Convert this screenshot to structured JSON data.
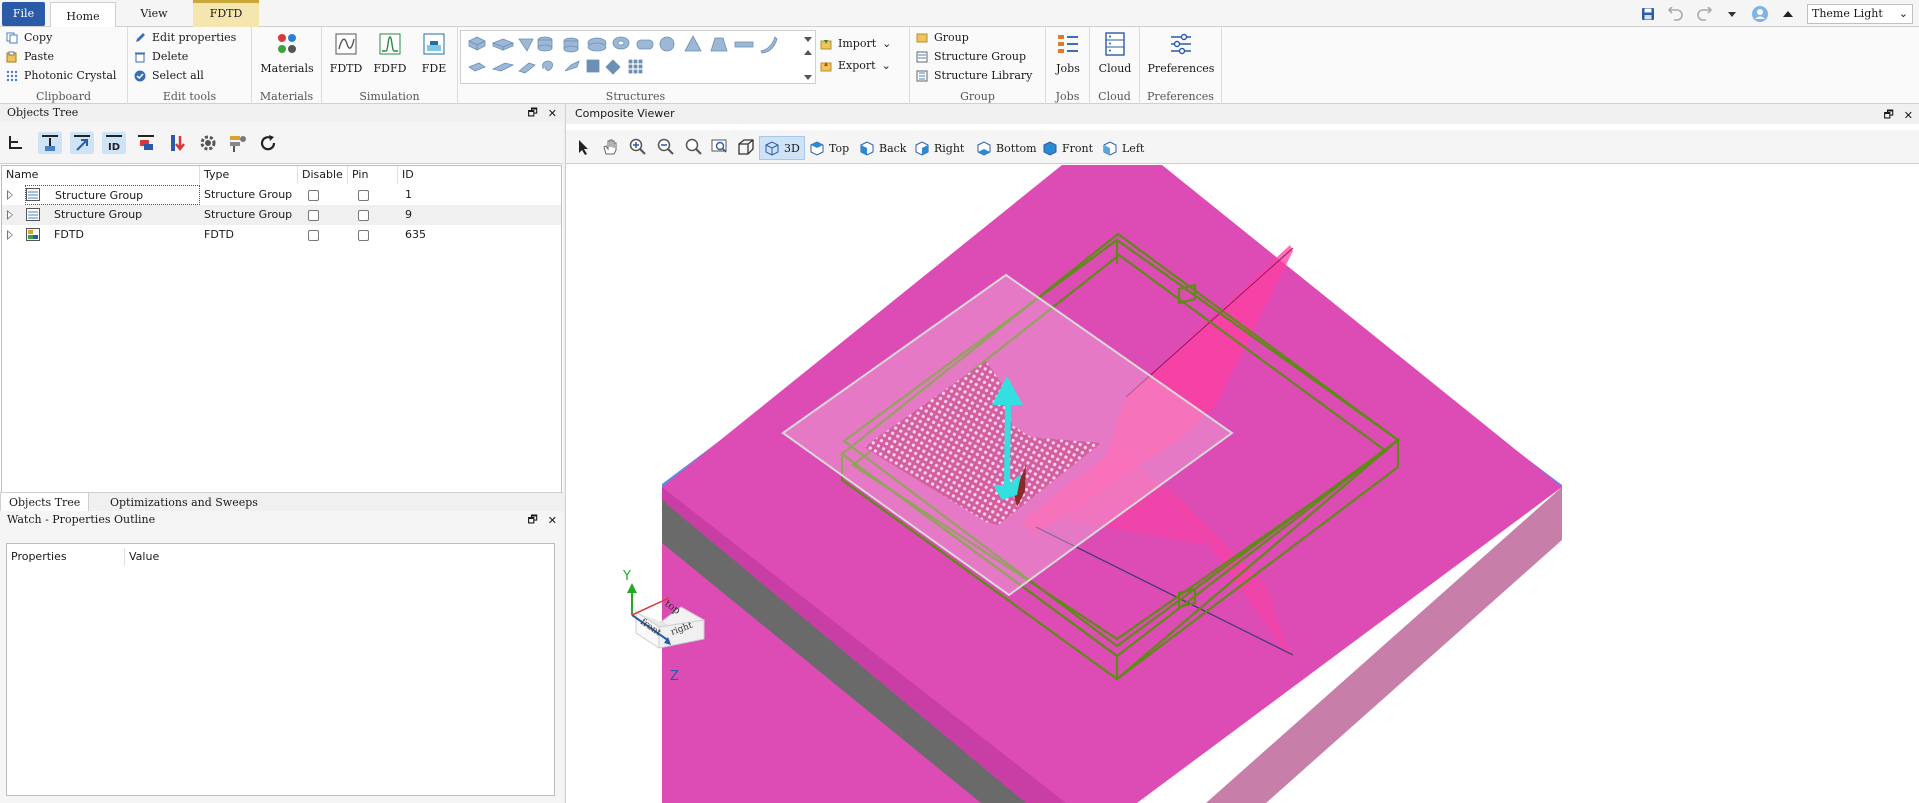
{
  "tabs": {
    "file": "File",
    "home": "Home",
    "view": "View",
    "fdtd": "FDTD"
  },
  "theme": {
    "label": "Theme Light"
  },
  "clipboard": {
    "copy": "Copy",
    "paste": "Paste",
    "photonic": "Photonic Crystal",
    "label": "Clipboard"
  },
  "edit": {
    "edit_properties": "Edit properties",
    "delete": "Delete",
    "select_all": "Select all",
    "label": "Edit tools"
  },
  "materials": {
    "button": "Materials",
    "label": "Materials"
  },
  "simulation": {
    "fdtd": "FDTD",
    "fdfd": "FDFD",
    "fde": "FDE",
    "label": "Simulation"
  },
  "structures": {
    "label": "Structures",
    "import": "Import",
    "export": "Export"
  },
  "group": {
    "group": "Group",
    "structure_group": "Structure Group",
    "structure_library": "Structure Library",
    "label": "Group"
  },
  "jobs": {
    "button": "Jobs",
    "label": "Jobs"
  },
  "cloud": {
    "button": "Cloud",
    "label": "Cloud"
  },
  "preferences": {
    "button": "Preferences",
    "label": "Preferences"
  },
  "objects_tree": {
    "title": "Objects Tree",
    "columns": [
      "Name",
      "Type",
      "Disable",
      "Pin",
      "ID"
    ],
    "rows": [
      {
        "name": "Structure Group",
        "type": "Structure Group",
        "id": "1"
      },
      {
        "name": "Structure Group",
        "type": "Structure Group",
        "id": "9"
      },
      {
        "name": "FDTD",
        "type": "FDTD",
        "id": "635"
      }
    ]
  },
  "bottom_tabs": {
    "objects": "Objects Tree",
    "opt": "Optimizations and Sweeps"
  },
  "watch": {
    "title": "Watch - Properties Outline",
    "col_props": "Properties",
    "col_value": "Value"
  },
  "viewer": {
    "title": "Composite Viewer",
    "views": {
      "v3d": "3D",
      "top": "Top",
      "back": "Back",
      "right": "Right",
      "bottom": "Bottom",
      "front": "Front",
      "left": "Left"
    },
    "axes": {
      "y": "Y",
      "z": "Z",
      "top": "top",
      "front": "front",
      "right": "right"
    }
  },
  "colors": {
    "accent": "#2b5aa8",
    "substrate": "#dc4cb4",
    "frame": "#5e8a18",
    "arrow": "#35dfe0"
  }
}
